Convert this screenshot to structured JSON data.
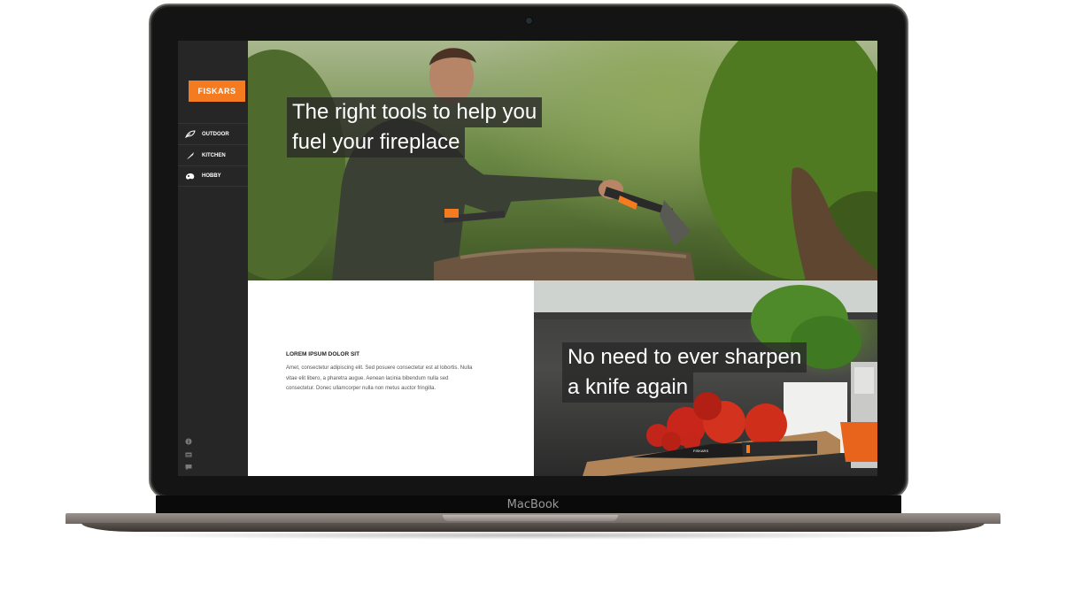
{
  "device": {
    "brand": "MacBook"
  },
  "sidebar": {
    "logo": "FISKARS",
    "items": [
      {
        "label": "OUTDOOR",
        "icon": "leaf-icon"
      },
      {
        "label": "KITCHEN",
        "icon": "knife-icon"
      },
      {
        "label": "HOBBY",
        "icon": "palette-icon"
      }
    ],
    "util_icons": [
      "info-icon",
      "list-icon",
      "chat-icon"
    ]
  },
  "hero": {
    "line1": "The right tools to help you",
    "line2": "fuel your fireplace"
  },
  "article": {
    "title": "LOREM IPSUM DOLOR SIT",
    "body": "Amet, consectetur adipiscing elit. Sed posuere consectetur est at lobortis. Nulla vitae elit libero, a pharetra augue. Aenean lacinia bibendum nulla sed consectetur. Donec ullamcorper nulla non metus auctor fringilla."
  },
  "kitchen": {
    "line1": "No need to ever sharpen",
    "line2": "a knife again",
    "knife_brand": "FISKARS"
  },
  "colors": {
    "brand": "#f47b20",
    "sidebar": "#262626"
  }
}
